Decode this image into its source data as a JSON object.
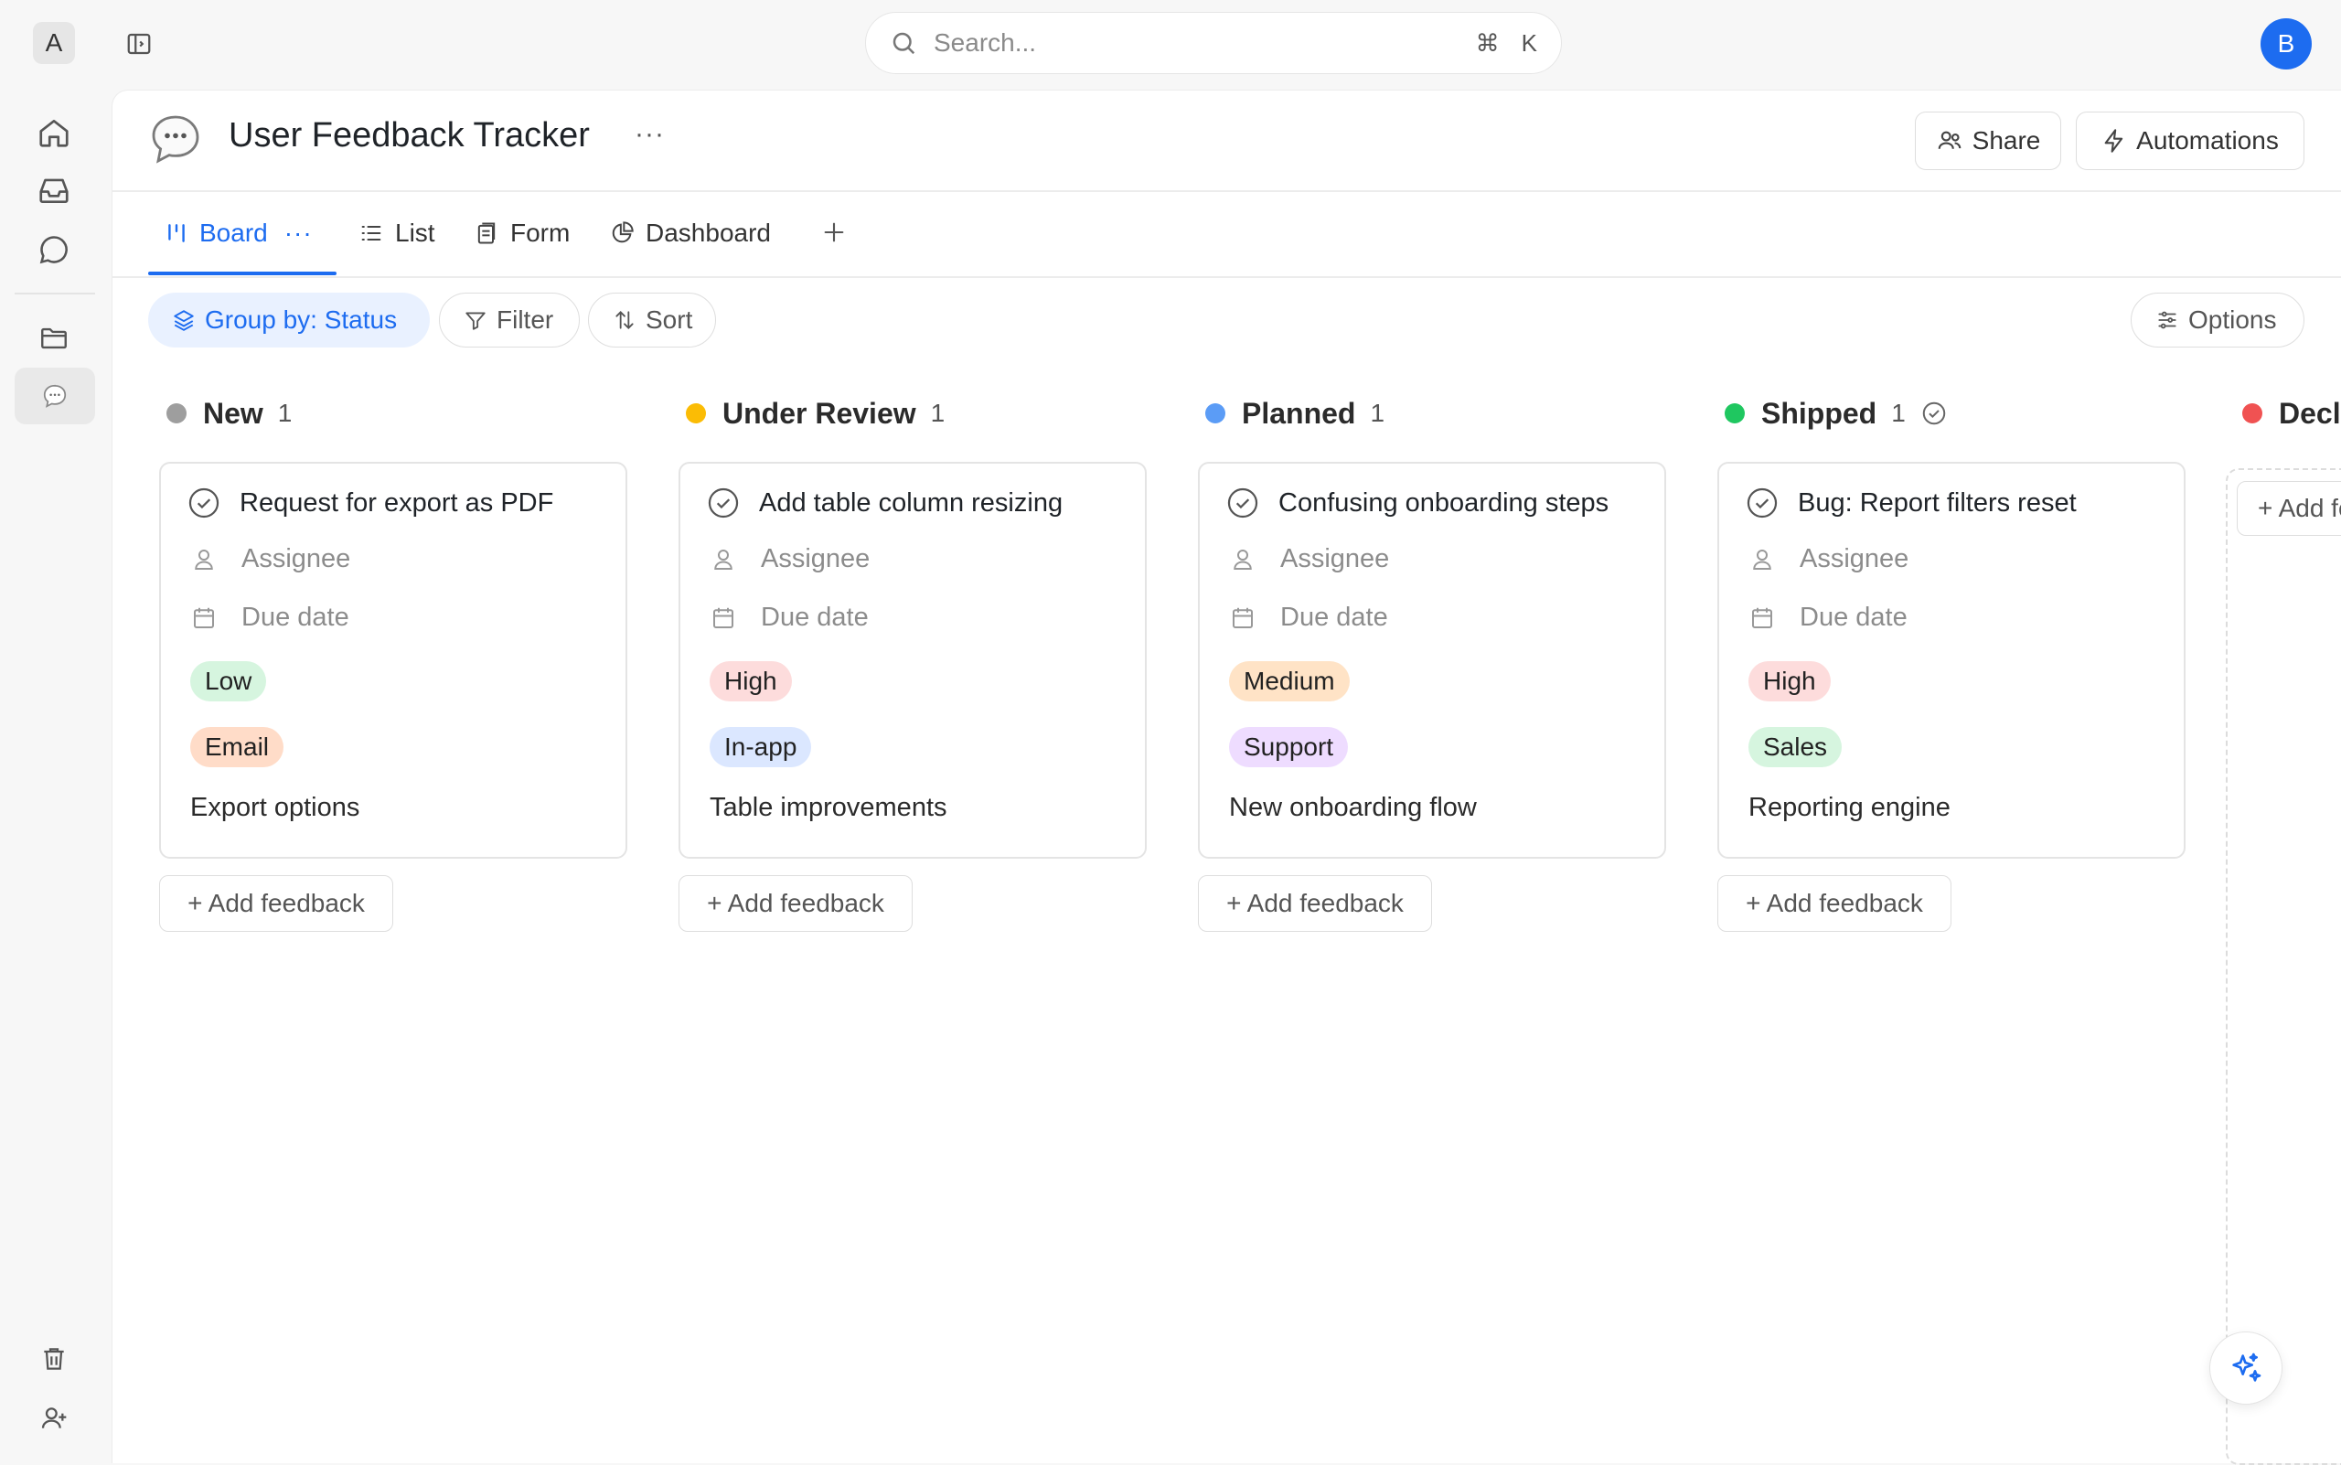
{
  "workspace": {
    "initial": "A"
  },
  "search": {
    "placeholder": "Search...",
    "shortcut_cmd": "⌘",
    "shortcut_key": "K"
  },
  "user": {
    "initial": "B"
  },
  "page": {
    "title": "User Feedback Tracker",
    "more": "···"
  },
  "header_actions": {
    "share_label": "Share",
    "automations_label": "Automations"
  },
  "tabs": [
    {
      "label": "Board",
      "icon": "board-icon",
      "active": true
    },
    {
      "label": "List",
      "icon": "list-icon"
    },
    {
      "label": "Form",
      "icon": "form-icon"
    },
    {
      "label": "Dashboard",
      "icon": "dashboard-icon"
    }
  ],
  "toolbar": {
    "groupby_label": "Group by: Status",
    "filter_label": "Filter",
    "sort_label": "Sort",
    "options_label": "Options"
  },
  "columns": [
    {
      "name": "New",
      "count": "1",
      "color": "#9e9e9e",
      "card": {
        "title": "Request for export as PDF",
        "assignee": "Assignee",
        "due": "Due date",
        "priority": "Low",
        "priority_color": "#d6f5df",
        "source": "Email",
        "source_color": "#ffdcc8",
        "project": "Export options"
      }
    },
    {
      "name": "Under Review",
      "count": "1",
      "color": "#fbbc05",
      "card": {
        "title": "Add table column resizing",
        "assignee": "Assignee",
        "due": "Due date",
        "priority": "High",
        "priority_color": "#fddcdc",
        "source": "In-app",
        "source_color": "#dbe7ff",
        "project": "Table improvements"
      }
    },
    {
      "name": "Planned",
      "count": "1",
      "color": "#5b9cf6",
      "card": {
        "title": "Confusing onboarding steps",
        "assignee": "Assignee",
        "due": "Due date",
        "priority": "Medium",
        "priority_color": "#ffe3c6",
        "source": "Support",
        "source_color": "#eedcff",
        "project": "New onboarding flow"
      }
    },
    {
      "name": "Shipped",
      "count": "1",
      "color": "#1fc760",
      "card": {
        "title": "Bug: Report filters reset",
        "assignee": "Assignee",
        "due": "Due date",
        "priority": "High",
        "priority_color": "#fddcdc",
        "source": "Sales",
        "source_color": "#d6f5df",
        "project": "Reporting engine"
      }
    },
    {
      "name": "Declined",
      "color": "#f05252"
    }
  ],
  "add_feedback_label": "+ Add feedback"
}
